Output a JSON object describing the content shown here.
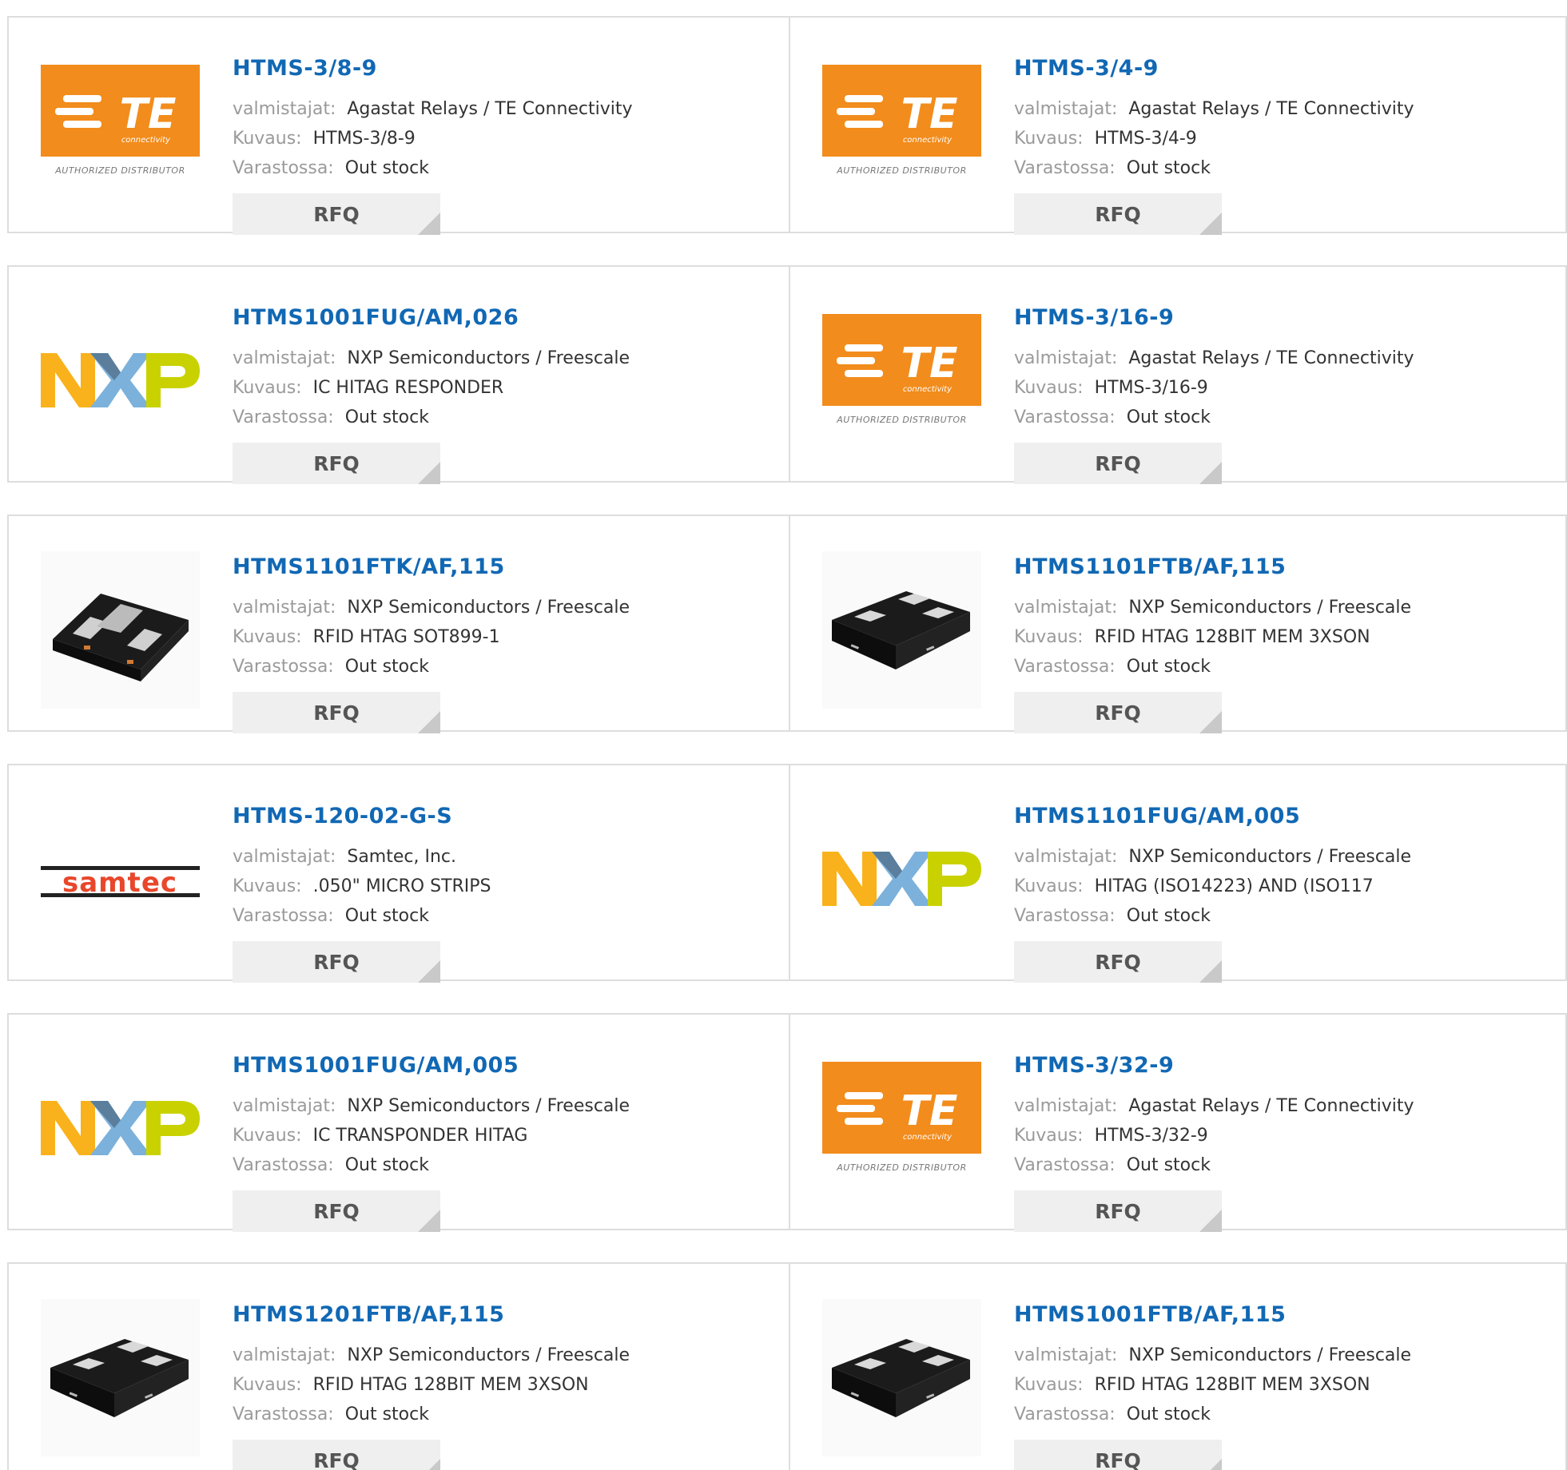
{
  "labels": {
    "manufacturer": "valmistajat:",
    "description": "Kuvaus:",
    "stock": "Varastossa:",
    "rfq": "RFQ"
  },
  "te_caption": "AUTHORIZED DISTRIBUTOR",
  "te_sub": "connectivity",
  "te_mark": "TE",
  "nxp_mark": "NXP",
  "samtec_mark": "samtec",
  "colors": {
    "link": "#1168b4",
    "te_orange": "#f28c1c",
    "nxp_yellow": "#f9b21b",
    "nxp_blue": "#7bb1db",
    "nxp_green": "#c9d200",
    "samtec_red": "#e8472b"
  },
  "products": [
    {
      "part": "HTMS-3/8-9",
      "manufacturer": "Agastat Relays / TE Connectivity",
      "description": "HTMS-3/8-9",
      "stock": "Out stock",
      "image": "te-logo"
    },
    {
      "part": "HTMS-3/4-9",
      "manufacturer": "Agastat Relays / TE Connectivity",
      "description": "HTMS-3/4-9",
      "stock": "Out stock",
      "image": "te-logo"
    },
    {
      "part": "HTMS1001FUG/AM,026",
      "manufacturer": "NXP Semiconductors / Freescale",
      "description": "IC HITAG RESPONDER",
      "stock": "Out stock",
      "image": "nxp-logo"
    },
    {
      "part": "HTMS-3/16-9",
      "manufacturer": "Agastat Relays / TE Connectivity",
      "description": "HTMS-3/16-9",
      "stock": "Out stock",
      "image": "te-logo"
    },
    {
      "part": "HTMS1101FTK/AF,115",
      "manufacturer": "NXP Semiconductors / Freescale",
      "description": "RFID HTAG SOT899-1",
      "stock": "Out stock",
      "image": "chip-sot899"
    },
    {
      "part": "HTMS1101FTB/AF,115",
      "manufacturer": "NXP Semiconductors / Freescale",
      "description": "RFID HTAG 128BIT MEM 3XSON",
      "stock": "Out stock",
      "image": "chip-xson"
    },
    {
      "part": "HTMS-120-02-G-S",
      "manufacturer": "Samtec, Inc.",
      "description": ".050\" MICRO STRIPS",
      "stock": "Out stock",
      "image": "samtec-logo"
    },
    {
      "part": "HTMS1101FUG/AM,005",
      "manufacturer": "NXP Semiconductors / Freescale",
      "description": "HITAG (ISO14223) AND (ISO117",
      "stock": "Out stock",
      "image": "nxp-logo"
    },
    {
      "part": "HTMS1001FUG/AM,005",
      "manufacturer": "NXP Semiconductors / Freescale",
      "description": "IC TRANSPONDER HITAG",
      "stock": "Out stock",
      "image": "nxp-logo"
    },
    {
      "part": "HTMS-3/32-9",
      "manufacturer": "Agastat Relays / TE Connectivity",
      "description": "HTMS-3/32-9",
      "stock": "Out stock",
      "image": "te-logo"
    },
    {
      "part": "HTMS1201FTB/AF,115",
      "manufacturer": "NXP Semiconductors / Freescale",
      "description": "RFID HTAG 128BIT MEM 3XSON",
      "stock": "Out stock",
      "image": "chip-xson"
    },
    {
      "part": "HTMS1001FTB/AF,115",
      "manufacturer": "NXP Semiconductors / Freescale",
      "description": "RFID HTAG 128BIT MEM 3XSON",
      "stock": "Out stock",
      "image": "chip-xson"
    }
  ]
}
